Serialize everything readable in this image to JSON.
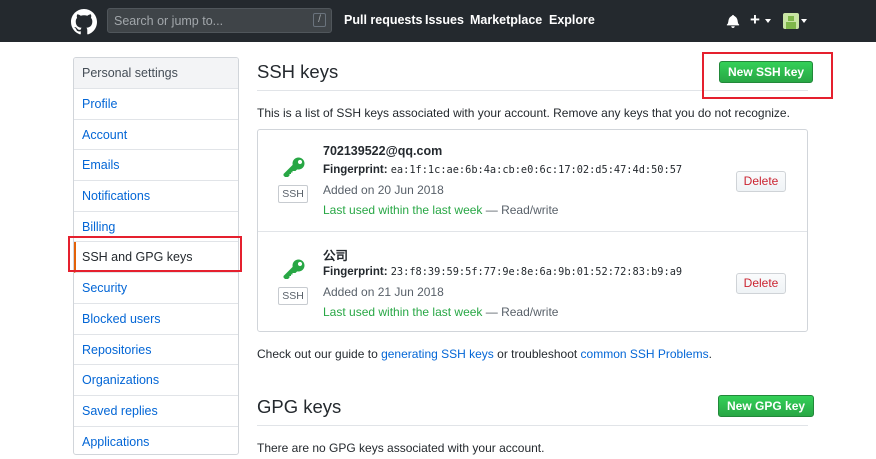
{
  "header": {
    "search_placeholder": "Search or jump to...",
    "search_shortcut": "/",
    "nav": [
      "Pull requests",
      "Issues",
      "Marketplace",
      "Explore"
    ],
    "plus": "+"
  },
  "sidebar": {
    "heading": "Personal settings",
    "items": [
      {
        "label": "Profile"
      },
      {
        "label": "Account"
      },
      {
        "label": "Emails"
      },
      {
        "label": "Notifications"
      },
      {
        "label": "Billing"
      },
      {
        "label": "SSH and GPG keys",
        "selected": true
      },
      {
        "label": "Security"
      },
      {
        "label": "Blocked users"
      },
      {
        "label": "Repositories"
      },
      {
        "label": "Organizations"
      },
      {
        "label": "Saved replies"
      },
      {
        "label": "Applications"
      }
    ]
  },
  "ssh": {
    "title": "SSH keys",
    "new_button": "New SSH key",
    "description": "This is a list of SSH keys associated with your account. Remove any keys that you do not recognize.",
    "keys": [
      {
        "title": "702139522@qq.com",
        "badge": "SSH",
        "fingerprint_label": "Fingerprint:",
        "fingerprint": "ea:1f:1c:ae:6b:4a:cb:e0:6c:17:02:d5:47:4d:50:57",
        "added": "Added on 20 Jun 2018",
        "last_used": "Last used within the last week",
        "access": " — Read/write",
        "delete_label": "Delete"
      },
      {
        "title": "公司",
        "badge": "SSH",
        "fingerprint_label": "Fingerprint:",
        "fingerprint": "23:f8:39:59:5f:77:9e:8e:6a:9b:01:52:72:83:b9:a9",
        "added": "Added on 21 Jun 2018",
        "last_used": "Last used within the last week",
        "access": " — Read/write",
        "delete_label": "Delete"
      }
    ],
    "guide_prefix": "Check out our guide to ",
    "guide_link": "generating SSH keys",
    "guide_middle": " or troubleshoot ",
    "guide_link2": "common SSH Problems",
    "guide_suffix": "."
  },
  "gpg": {
    "title": "GPG keys",
    "new_button": "New GPG key",
    "description": "There are no GPG keys associated with your account."
  },
  "colors": {
    "header_bg": "#24292e",
    "link": "#0366d6",
    "green": "#28a745",
    "delete": "#cb2431",
    "highlight": "#e5202e"
  }
}
